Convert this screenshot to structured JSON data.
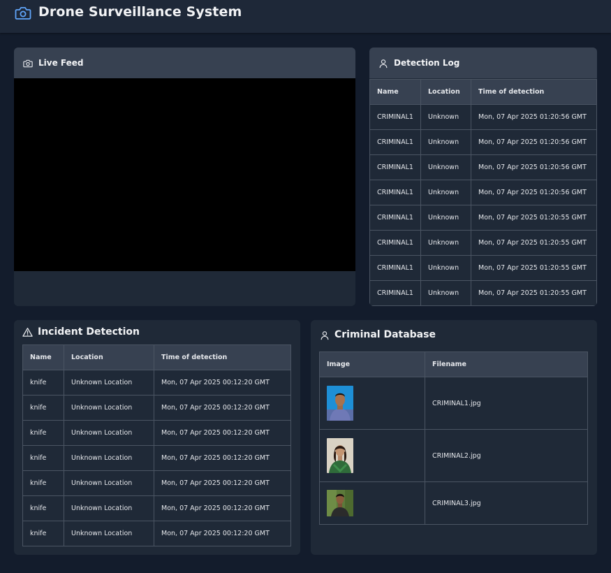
{
  "app": {
    "title": "Drone Surveillance System",
    "icon": "camera-icon"
  },
  "live_feed": {
    "title": "Live Feed",
    "icon": "camera-icon"
  },
  "detection_log": {
    "title": "Detection Log",
    "icon": "user-icon",
    "columns": [
      "Name",
      "Location",
      "Time of detection"
    ],
    "rows": [
      [
        "CRIMINAL1",
        "Unknown",
        "Mon, 07 Apr 2025 01:20:56 GMT"
      ],
      [
        "CRIMINAL1",
        "Unknown",
        "Mon, 07 Apr 2025 01:20:56 GMT"
      ],
      [
        "CRIMINAL1",
        "Unknown",
        "Mon, 07 Apr 2025 01:20:56 GMT"
      ],
      [
        "CRIMINAL1",
        "Unknown",
        "Mon, 07 Apr 2025 01:20:56 GMT"
      ],
      [
        "CRIMINAL1",
        "Unknown",
        "Mon, 07 Apr 2025 01:20:55 GMT"
      ],
      [
        "CRIMINAL1",
        "Unknown",
        "Mon, 07 Apr 2025 01:20:55 GMT"
      ],
      [
        "CRIMINAL1",
        "Unknown",
        "Mon, 07 Apr 2025 01:20:55 GMT"
      ],
      [
        "CRIMINAL1",
        "Unknown",
        "Mon, 07 Apr 2025 01:20:55 GMT"
      ]
    ]
  },
  "incident_detection": {
    "title": "Incident Detection",
    "icon": "warning-icon",
    "columns": [
      "Name",
      "Location",
      "Time of detection"
    ],
    "rows": [
      [
        "knife",
        "Unknown Location",
        "Mon, 07 Apr 2025 00:12:20 GMT"
      ],
      [
        "knife",
        "Unknown Location",
        "Mon, 07 Apr 2025 00:12:20 GMT"
      ],
      [
        "knife",
        "Unknown Location",
        "Mon, 07 Apr 2025 00:12:20 GMT"
      ],
      [
        "knife",
        "Unknown Location",
        "Mon, 07 Apr 2025 00:12:20 GMT"
      ],
      [
        "knife",
        "Unknown Location",
        "Mon, 07 Apr 2025 00:12:20 GMT"
      ],
      [
        "knife",
        "Unknown Location",
        "Mon, 07 Apr 2025 00:12:20 GMT"
      ],
      [
        "knife",
        "Unknown Location",
        "Mon, 07 Apr 2025 00:12:20 GMT"
      ]
    ]
  },
  "criminal_database": {
    "title": "Criminal Database",
    "icon": "user-icon",
    "columns": [
      "Image",
      "Filename"
    ],
    "rows": [
      {
        "filename": "CRIMINAL1.jpg"
      },
      {
        "filename": "CRIMINAL2.jpg"
      },
      {
        "filename": "CRIMINAL3.jpg"
      }
    ]
  },
  "colors": {
    "accent": "#60a5fa",
    "background": "#131c2c",
    "card": "#1f2937",
    "card_header": "#374151",
    "border": "#4b5563"
  }
}
